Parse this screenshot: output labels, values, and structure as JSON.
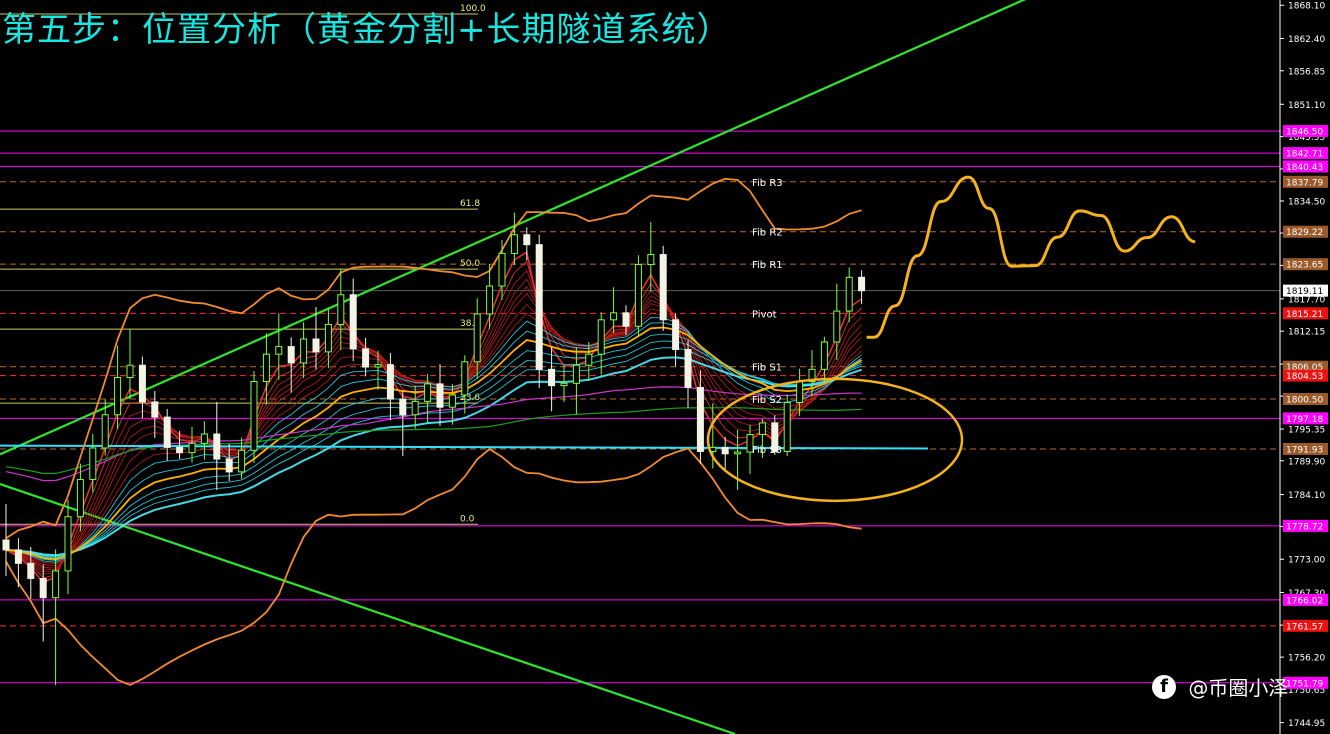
{
  "title": "第五步：位置分析（黄金分割+长期隧道系统）",
  "watermark": {
    "icon": "f",
    "text": "@币圈小泽"
  },
  "colors": {
    "background": "#000000",
    "axis": "#ffffff",
    "title": "#18e6e0",
    "channel": "#2ee52e",
    "bollinger": "#f28a2e",
    "projection": "#f5b21a",
    "magenta_level": "#ff00ff",
    "red_level": "#ff2a2a",
    "brown_level": "#b86a2e",
    "fib_line": "#f0f07a",
    "tunnel_fast": "#ff2020",
    "tunnel_slow": "#27d8f0"
  },
  "chart_data": {
    "type": "candlestick",
    "y_axis": {
      "range": [
        1743.0,
        1869.0
      ],
      "ticks": [
        "1868.10",
        "1862.40",
        "1856.85",
        "1851.10",
        "1845.55",
        "1840.00",
        "1834.50",
        "1829.00",
        "1823.45",
        "1817.70",
        "1812.15",
        "1806.50",
        "1801.00",
        "1795.35",
        "1789.90",
        "1784.10",
        "1778.60",
        "1773.00",
        "1767.30",
        "1761.70",
        "1756.20",
        "1750.65",
        "1744.95"
      ]
    },
    "price_labels": [
      {
        "value": 1846.5,
        "text": "1846.50",
        "kind": "magenta"
      },
      {
        "value": 1842.71,
        "text": "1842.71",
        "kind": "magenta"
      },
      {
        "value": 1840.43,
        "text": "1840.43",
        "kind": "magenta"
      },
      {
        "value": 1837.79,
        "text": "1837.79",
        "kind": "brown"
      },
      {
        "value": 1829.22,
        "text": "1829.22",
        "kind": "brown"
      },
      {
        "value": 1823.65,
        "text": "1823.65",
        "kind": "brown"
      },
      {
        "value": 1819.11,
        "text": "1819.11",
        "kind": "current"
      },
      {
        "value": 1815.21,
        "text": "1815.21",
        "kind": "red"
      },
      {
        "value": 1806.05,
        "text": "1806.05",
        "kind": "brown"
      },
      {
        "value": 1804.53,
        "text": "1804.53",
        "kind": "red"
      },
      {
        "value": 1800.5,
        "text": "1800.50",
        "kind": "brown"
      },
      {
        "value": 1797.18,
        "text": "1797.18",
        "kind": "magenta"
      },
      {
        "value": 1791.93,
        "text": "1791.93",
        "kind": "brown"
      },
      {
        "value": 1778.72,
        "text": "1778.72",
        "kind": "magenta"
      },
      {
        "value": 1766.02,
        "text": "1766.02",
        "kind": "magenta"
      },
      {
        "value": 1761.57,
        "text": "1761.57",
        "kind": "red"
      },
      {
        "value": 1751.79,
        "text": "1751.79",
        "kind": "magenta"
      }
    ],
    "pivot_labels": [
      {
        "text": "Fib R3",
        "value": 1837.79
      },
      {
        "text": "Fib R2",
        "value": 1829.22
      },
      {
        "text": "Fib R1",
        "value": 1823.65
      },
      {
        "text": "Pivot",
        "value": 1815.21
      },
      {
        "text": "Fib S1",
        "value": 1806.05
      },
      {
        "text": "Fib S2",
        "value": 1800.5
      },
      {
        "text": "Fib S3",
        "value": 1791.93
      }
    ],
    "fib_levels": [
      {
        "text": "100.0",
        "value": 1866.6
      },
      {
        "text": "61.8",
        "value": 1833.1
      },
      {
        "text": "50.0",
        "value": 1822.8
      },
      {
        "text": "38.2",
        "value": 1812.5
      },
      {
        "text": "23.6",
        "value": 1799.8
      },
      {
        "text": "0.0",
        "value": 1779.0
      }
    ],
    "candles": [
      {
        "o": 1776.3,
        "h": 1782.5,
        "l": 1770.1,
        "c": 1774.6
      },
      {
        "o": 1774.6,
        "h": 1776.6,
        "l": 1768.2,
        "c": 1772.3
      },
      {
        "o": 1772.3,
        "h": 1775.1,
        "l": 1766.2,
        "c": 1769.7
      },
      {
        "o": 1769.7,
        "h": 1772.1,
        "l": 1758.9,
        "c": 1766.4
      },
      {
        "o": 1766.4,
        "h": 1774.7,
        "l": 1751.4,
        "c": 1771.0
      },
      {
        "o": 1771.0,
        "h": 1783.2,
        "l": 1767.0,
        "c": 1780.3
      },
      {
        "o": 1780.3,
        "h": 1789.4,
        "l": 1777.8,
        "c": 1786.7
      },
      {
        "o": 1786.7,
        "h": 1794.5,
        "l": 1784.5,
        "c": 1792.1
      },
      {
        "o": 1792.1,
        "h": 1800.4,
        "l": 1790.8,
        "c": 1797.8
      },
      {
        "o": 1797.8,
        "h": 1809.7,
        "l": 1795.3,
        "c": 1804.2
      },
      {
        "o": 1804.2,
        "h": 1812.5,
        "l": 1800.5,
        "c": 1806.3
      },
      {
        "o": 1806.3,
        "h": 1807.8,
        "l": 1797.2,
        "c": 1800.0
      },
      {
        "o": 1800.0,
        "h": 1801.9,
        "l": 1793.8,
        "c": 1797.4
      },
      {
        "o": 1797.4,
        "h": 1798.8,
        "l": 1789.9,
        "c": 1792.2
      },
      {
        "o": 1792.2,
        "h": 1795.0,
        "l": 1790.2,
        "c": 1791.3
      },
      {
        "o": 1791.3,
        "h": 1795.7,
        "l": 1789.6,
        "c": 1792.9
      },
      {
        "o": 1792.9,
        "h": 1796.7,
        "l": 1790.1,
        "c": 1794.5
      },
      {
        "o": 1794.5,
        "h": 1800.0,
        "l": 1784.9,
        "c": 1790.2
      },
      {
        "o": 1790.2,
        "h": 1792.8,
        "l": 1786.4,
        "c": 1788.0
      },
      {
        "o": 1788.0,
        "h": 1793.9,
        "l": 1786.8,
        "c": 1791.7
      },
      {
        "o": 1791.7,
        "h": 1805.3,
        "l": 1789.5,
        "c": 1803.5
      },
      {
        "o": 1803.5,
        "h": 1811.8,
        "l": 1799.5,
        "c": 1808.2
      },
      {
        "o": 1808.2,
        "h": 1815.2,
        "l": 1803.8,
        "c": 1809.5
      },
      {
        "o": 1809.5,
        "h": 1811.1,
        "l": 1801.6,
        "c": 1806.7
      },
      {
        "o": 1806.7,
        "h": 1813.7,
        "l": 1804.1,
        "c": 1810.8
      },
      {
        "o": 1810.8,
        "h": 1816.3,
        "l": 1805.6,
        "c": 1808.6
      },
      {
        "o": 1808.6,
        "h": 1816.2,
        "l": 1805.8,
        "c": 1813.3
      },
      {
        "o": 1813.3,
        "h": 1822.9,
        "l": 1808.9,
        "c": 1818.4
      },
      {
        "o": 1818.4,
        "h": 1821.2,
        "l": 1807.0,
        "c": 1809.1
      },
      {
        "o": 1809.1,
        "h": 1811.0,
        "l": 1804.4,
        "c": 1806.0
      },
      {
        "o": 1806.0,
        "h": 1808.8,
        "l": 1802.1,
        "c": 1806.4
      },
      {
        "o": 1806.4,
        "h": 1808.4,
        "l": 1796.9,
        "c": 1800.5
      },
      {
        "o": 1800.5,
        "h": 1801.9,
        "l": 1790.7,
        "c": 1797.8
      },
      {
        "o": 1797.8,
        "h": 1802.8,
        "l": 1795.4,
        "c": 1800.1
      },
      {
        "o": 1800.1,
        "h": 1804.8,
        "l": 1796.4,
        "c": 1803.1
      },
      {
        "o": 1803.1,
        "h": 1806.5,
        "l": 1795.9,
        "c": 1799.1
      },
      {
        "o": 1799.1,
        "h": 1803.1,
        "l": 1796.1,
        "c": 1801.2
      },
      {
        "o": 1801.2,
        "h": 1808.0,
        "l": 1798.0,
        "c": 1806.9
      },
      {
        "o": 1806.9,
        "h": 1817.8,
        "l": 1804.0,
        "c": 1815.1
      },
      {
        "o": 1815.1,
        "h": 1823.7,
        "l": 1812.5,
        "c": 1819.9
      },
      {
        "o": 1819.9,
        "h": 1827.8,
        "l": 1817.5,
        "c": 1825.5
      },
      {
        "o": 1825.5,
        "h": 1832.5,
        "l": 1823.5,
        "c": 1828.7
      },
      {
        "o": 1828.7,
        "h": 1830.0,
        "l": 1824.3,
        "c": 1827.0
      },
      {
        "o": 1827.0,
        "h": 1828.7,
        "l": 1802.4,
        "c": 1805.6
      },
      {
        "o": 1805.6,
        "h": 1809.4,
        "l": 1798.4,
        "c": 1802.8
      },
      {
        "o": 1802.8,
        "h": 1806.2,
        "l": 1800.0,
        "c": 1803.2
      },
      {
        "o": 1803.2,
        "h": 1809.4,
        "l": 1797.9,
        "c": 1806.3
      },
      {
        "o": 1806.3,
        "h": 1810.3,
        "l": 1803.6,
        "c": 1808.2
      },
      {
        "o": 1808.2,
        "h": 1815.4,
        "l": 1804.7,
        "c": 1814.1
      },
      {
        "o": 1814.1,
        "h": 1819.7,
        "l": 1811.8,
        "c": 1815.3
      },
      {
        "o": 1815.3,
        "h": 1816.6,
        "l": 1811.5,
        "c": 1813.0
      },
      {
        "o": 1813.0,
        "h": 1825.2,
        "l": 1811.3,
        "c": 1823.6
      },
      {
        "o": 1823.6,
        "h": 1830.9,
        "l": 1818.9,
        "c": 1825.3
      },
      {
        "o": 1825.3,
        "h": 1826.8,
        "l": 1812.2,
        "c": 1814.1
      },
      {
        "o": 1814.1,
        "h": 1815.2,
        "l": 1806.1,
        "c": 1809.0
      },
      {
        "o": 1809.0,
        "h": 1810.6,
        "l": 1799.0,
        "c": 1802.5
      },
      {
        "o": 1802.5,
        "h": 1805.4,
        "l": 1789.4,
        "c": 1791.5
      },
      {
        "o": 1791.5,
        "h": 1799.8,
        "l": 1788.6,
        "c": 1792.2
      },
      {
        "o": 1792.2,
        "h": 1794.0,
        "l": 1788.1,
        "c": 1791.1
      },
      {
        "o": 1791.1,
        "h": 1795.2,
        "l": 1784.9,
        "c": 1791.4
      },
      {
        "o": 1791.4,
        "h": 1796.1,
        "l": 1787.6,
        "c": 1794.4
      },
      {
        "o": 1794.4,
        "h": 1797.1,
        "l": 1790.4,
        "c": 1796.4
      },
      {
        "o": 1796.4,
        "h": 1797.7,
        "l": 1790.9,
        "c": 1791.5
      },
      {
        "o": 1791.5,
        "h": 1801.3,
        "l": 1790.7,
        "c": 1799.9
      },
      {
        "o": 1799.9,
        "h": 1805.7,
        "l": 1797.6,
        "c": 1803.5
      },
      {
        "o": 1803.5,
        "h": 1808.9,
        "l": 1801.0,
        "c": 1805.6
      },
      {
        "o": 1805.6,
        "h": 1811.2,
        "l": 1803.5,
        "c": 1810.3
      },
      {
        "o": 1810.3,
        "h": 1820.3,
        "l": 1807.2,
        "c": 1815.6
      },
      {
        "o": 1815.6,
        "h": 1823.1,
        "l": 1813.7,
        "c": 1821.4
      },
      {
        "o": 1821.4,
        "h": 1822.6,
        "l": 1816.8,
        "c": 1819.1
      }
    ],
    "projection_path": [
      {
        "candle_index": 69.4,
        "price": 1811.1
      },
      {
        "candle_index": 70.0,
        "price": 1811.1
      },
      {
        "candle_index": 71.7,
        "price": 1816.5
      },
      {
        "candle_index": 73.5,
        "price": 1825.1
      },
      {
        "candle_index": 75.4,
        "price": 1834.4
      },
      {
        "candle_index": 77.6,
        "price": 1838.6
      },
      {
        "candle_index": 79.3,
        "price": 1833.2
      },
      {
        "candle_index": 81.1,
        "price": 1823.3
      },
      {
        "candle_index": 83.0,
        "price": 1823.4
      },
      {
        "candle_index": 84.8,
        "price": 1828.3
      },
      {
        "candle_index": 86.6,
        "price": 1832.8
      },
      {
        "candle_index": 88.3,
        "price": 1832.0
      },
      {
        "candle_index": 90.2,
        "price": 1825.9
      },
      {
        "candle_index": 92.0,
        "price": 1828.2
      },
      {
        "candle_index": 94.0,
        "price": 1831.8
      },
      {
        "candle_index": 95.9,
        "price": 1827.5
      }
    ]
  }
}
